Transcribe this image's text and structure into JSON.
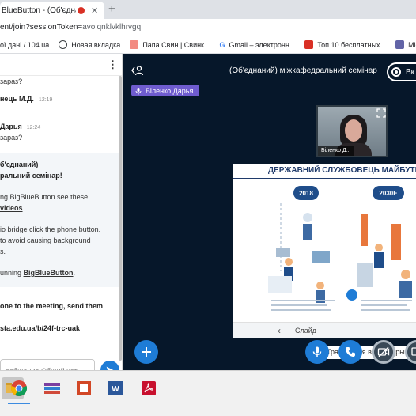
{
  "browser": {
    "tab_title": "BlueButton - (Об'єднаний",
    "tab_close": "✕",
    "new_tab": "+",
    "url_prefix": "ent/join?sessionToken=",
    "url_token": "avolqnklvklhrvgq",
    "bookmarks": [
      {
        "label": "ої дані / 104.ua",
        "icon": "bookmark-icon",
        "color": "#e0e0e0"
      },
      {
        "label": "Новая вкладка",
        "icon": "globe-icon",
        "color": "#3c4043"
      },
      {
        "label": "Папа Свин | Свинк...",
        "icon": "image-icon",
        "color": "#f28b82"
      },
      {
        "label": "Gmail – электронн...",
        "icon": "google-icon",
        "color": "#4285f4"
      },
      {
        "label": "Топ 10 бесплатных...",
        "icon": "red-bookmark-icon",
        "color": "#d93025"
      },
      {
        "label": "Microsoft Tean",
        "icon": "teams-icon",
        "color": "#6264a7"
      }
    ]
  },
  "chat": {
    "menu": "⋮",
    "messages": [
      {
        "text": "зараз?",
        "kind": "text"
      },
      {
        "name": "нець М.Д.",
        "time": "12:19",
        "kind": "name"
      },
      {
        "name": "Дарья",
        "time": "12:24",
        "kind": "name"
      },
      {
        "text": "зараз?",
        "kind": "text"
      }
    ],
    "welcome": {
      "line1": "б'єднаний)",
      "line2": "ральний семінар!",
      "line3": "ng BigBlueButton see these",
      "line4": "videos",
      "line4_tail": ".",
      "line5": "io bridge click the phone button.",
      "line6": "to avoid causing background",
      "line7": "s.",
      "line8": "unning ",
      "line8_link": "BigBlueButton",
      "line8_tail": "."
    },
    "invite": {
      "line1": "one to the meeting, send them",
      "line2": "sta.edu.ua/b/24f-trc-uak"
    },
    "input_placeholder": "ообщение Общий чат",
    "send_icon": "send-icon"
  },
  "stage": {
    "meeting_title": "(Об'єднаний) міжкафедральний семінар",
    "record_label": "Вк",
    "talker_name": "Біленко Дарья",
    "webcam_name": "Біленко Д...",
    "slide": {
      "title": "ДЕРЖАВНИЙ СЛУЖБОВЕЦЬ МАЙБУТНЬ",
      "year_left": "2018",
      "year_right": "2030Е",
      "nav_prev": "‹",
      "nav_label": "Слайд"
    },
    "tooltip": "Трансляция вебкамеры запус"
  },
  "colors": {
    "stage_bg": "#06172a",
    "accent_blue": "#1e7cd6",
    "talker_purple": "#6f5ccf"
  }
}
